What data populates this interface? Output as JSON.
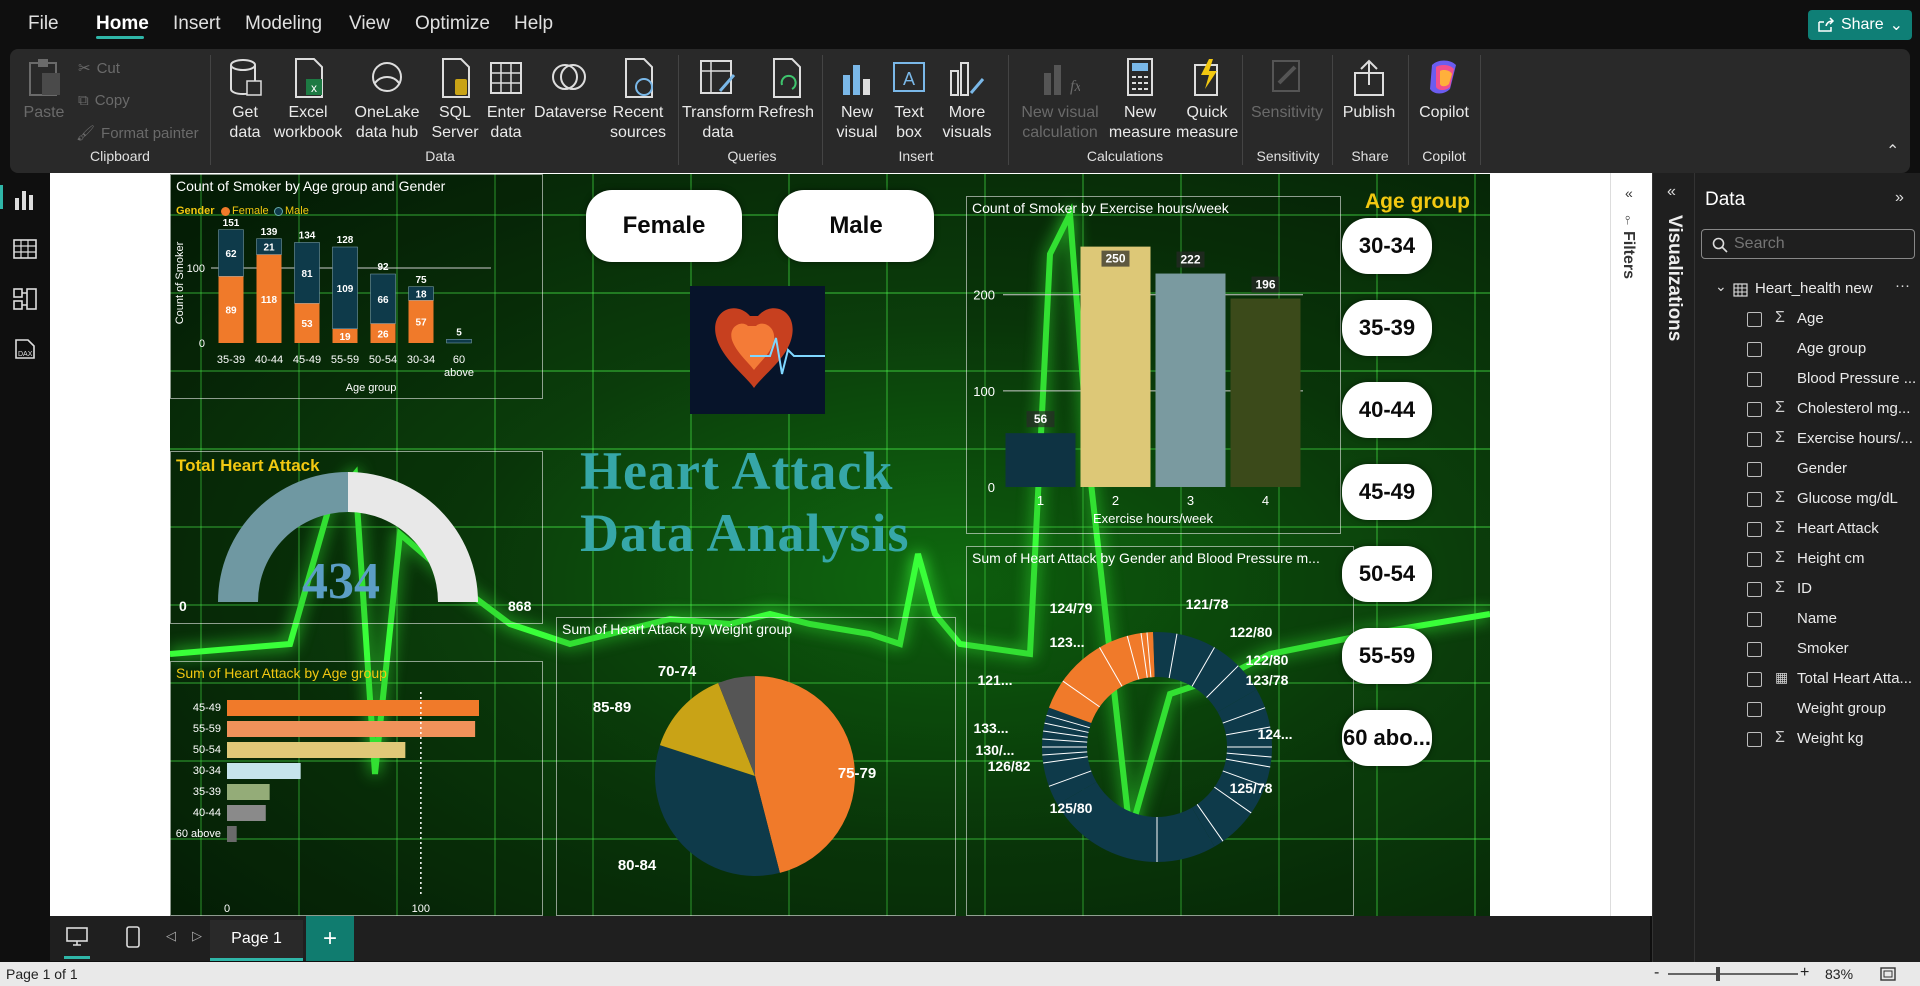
{
  "menu": {
    "file": "File",
    "home": "Home",
    "insert": "Insert",
    "modeling": "Modeling",
    "view": "View",
    "optimize": "Optimize",
    "help": "Help",
    "share": "Share",
    "accent": "#0f7f76"
  },
  "ribbon": {
    "paste": "Paste",
    "cut": "Cut",
    "copy": "Copy",
    "format_painter": "Format painter",
    "clipboard": "Clipboard",
    "get_data": "Get data",
    "excel": "Excel workbook",
    "onelake": "OneLake data hub",
    "sql": "SQL Server",
    "enter_data": "Enter data",
    "dataverse": "Dataverse",
    "recent": "Recent sources",
    "data": "Data",
    "transform": "Transform data",
    "refresh": "Refresh",
    "queries": "Queries",
    "new_visual": "New visual",
    "text_box": "Text box",
    "more_visuals": "More visuals",
    "insert": "Insert",
    "new_visual_calc": "New visual calculation",
    "new_measure": "New measure",
    "quick_measure": "Quick measure",
    "calculations": "Calculations",
    "sensitivity": "Sensitivity",
    "sensitivity_group": "Sensitivity",
    "publish": "Publish",
    "share_group": "Share",
    "copilot": "Copilot",
    "copilot_group": "Copilot"
  },
  "report": {
    "title_line1": "Heart Attack",
    "title_line2": "Data  Analysis",
    "gender_female": "Female",
    "gender_male": "Male",
    "age_slicer_title": "Age group",
    "age_slicer_items": [
      "30-34",
      "35-39",
      "40-44",
      "45-49",
      "50-54",
      "55-59",
      "60 abo..."
    ],
    "smoker_age_gender": {
      "title": "Count of Smoker by Age group and Gender",
      "legend_title": "Gender",
      "legend_female": "Female",
      "legend_male": "Male",
      "ylabel": "Count of Smoker",
      "xlabel": "Age group"
    },
    "total_heart_attack": {
      "title": "Total Heart Attack",
      "value": "434",
      "min": "0",
      "max": "868",
      "fill_fraction": 0.5
    },
    "heart_attack_age": {
      "title": "Sum of Heart Attack by Age group"
    },
    "weight_group": {
      "title": "Sum of Heart Attack by Weight group"
    },
    "exercise": {
      "title": "Count of Smoker by Exercise hours/week",
      "xlabel": "Exercise hours/week"
    },
    "bp": {
      "title": "Sum of Heart Attack by Gender and Blood Pressure m...",
      "labels": [
        "124/79",
        "121/78",
        "122/80",
        "122/80",
        "123/78",
        "121...",
        "123...",
        "124...",
        "133...",
        "130/...",
        "126/82",
        "125/78",
        "125/80"
      ]
    }
  },
  "chart_data": [
    {
      "type": "bar",
      "title": "Count of Smoker by Age group and Gender",
      "categories": [
        "35-39",
        "40-44",
        "45-49",
        "55-59",
        "50-54",
        "30-34",
        "60 above"
      ],
      "series": [
        {
          "name": "Female",
          "values": [
            89,
            118,
            53,
            19,
            26,
            57,
            0
          ]
        },
        {
          "name": "Male",
          "values": [
            62,
            21,
            81,
            109,
            66,
            18,
            5
          ]
        }
      ],
      "totals": [
        151,
        139,
        134,
        128,
        92,
        75,
        5
      ],
      "xlabel": "Age group",
      "ylabel": "Count of Smoker",
      "ylim": [
        0,
        160
      ],
      "yticks": [
        0,
        100
      ]
    },
    {
      "type": "bar",
      "title": "Sum of Heart Attack by Age group",
      "orientation": "horizontal",
      "categories": [
        "45-49",
        "55-59",
        "50-54",
        "30-34",
        "35-39",
        "40-44",
        "60 above"
      ],
      "values": [
        130,
        128,
        92,
        38,
        22,
        20,
        5
      ],
      "colors": [
        "#f07a2a",
        "#f0925a",
        "#e0c878",
        "#c6e4ec",
        "#94ac78",
        "#8a8a8a",
        "#6a6a6a"
      ],
      "xlim": [
        0,
        130
      ],
      "xticks": [
        0,
        100
      ]
    },
    {
      "type": "pie",
      "title": "Sum of Heart Attack by Weight group",
      "labels": [
        "75-79",
        "80-84",
        "85-89",
        "70-74"
      ],
      "values": [
        46,
        34,
        14,
        6
      ],
      "colors": [
        "#f07a2a",
        "#0e3a4a",
        "#c9a316",
        "#555555"
      ]
    },
    {
      "type": "bar",
      "title": "Count of Smoker by Exercise hours/week",
      "categories": [
        "1",
        "2",
        "3",
        "4"
      ],
      "values": [
        56,
        250,
        222,
        196
      ],
      "colors": [
        "#0e3343",
        "#ddc877",
        "#7a9aa0",
        "#3b4a1a"
      ],
      "xlabel": "Exercise hours/week",
      "ylim": [
        0,
        260
      ],
      "yticks": [
        0,
        100,
        200
      ]
    }
  ],
  "filters_pane": {
    "label": "Filters"
  },
  "viz_pane": {
    "label": "Visualizations"
  },
  "data_pane": {
    "title": "Data",
    "search_placeholder": "Search",
    "table_name": "Heart_health new",
    "fields": [
      {
        "name": "Age",
        "icon": "sigma"
      },
      {
        "name": "Age group",
        "icon": ""
      },
      {
        "name": "Blood Pressure ...",
        "icon": ""
      },
      {
        "name": "Cholesterol mg...",
        "icon": "sigma"
      },
      {
        "name": "Exercise hours/...",
        "icon": "sigma"
      },
      {
        "name": "Gender",
        "icon": ""
      },
      {
        "name": "Glucose mg/dL",
        "icon": "sigma"
      },
      {
        "name": "Heart Attack",
        "icon": "sigma"
      },
      {
        "name": "Height cm",
        "icon": "sigma"
      },
      {
        "name": "ID",
        "icon": "sigma"
      },
      {
        "name": "Name",
        "icon": ""
      },
      {
        "name": "Smoker",
        "icon": ""
      },
      {
        "name": "Total Heart Atta...",
        "icon": "calc"
      },
      {
        "name": "Weight group",
        "icon": ""
      },
      {
        "name": "Weight kg",
        "icon": "sigma"
      }
    ]
  },
  "pages": {
    "tab": "Page 1",
    "add": "+"
  },
  "status": {
    "page_info": "Page 1 of 1",
    "zoom": "83%",
    "zoom_minus": "-",
    "zoom_plus": "+"
  }
}
